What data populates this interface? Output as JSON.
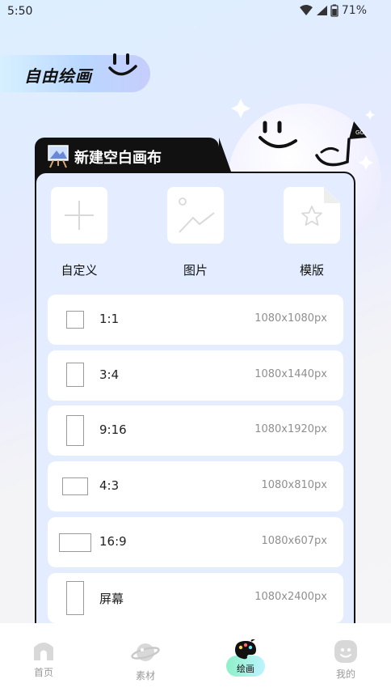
{
  "status_bar": {
    "time": "5:50",
    "battery": "71%"
  },
  "header": {
    "title": "自由绘画"
  },
  "card": {
    "tab_title": "新建空白画布",
    "options": [
      {
        "label": "自定义",
        "icon": "plus-icon"
      },
      {
        "label": "图片",
        "icon": "image-icon"
      },
      {
        "label": "模版",
        "icon": "star-doc-icon"
      }
    ],
    "ratios": [
      {
        "ratio": "1:1",
        "size": "1080x1080px"
      },
      {
        "ratio": "3:4",
        "size": "1080x1440px"
      },
      {
        "ratio": "9:16",
        "size": "1080x1920px"
      },
      {
        "ratio": "4:3",
        "size": "1080x810px"
      },
      {
        "ratio": "16:9",
        "size": "1080x607px"
      },
      {
        "ratio": "屏幕",
        "size": "1080x2400px"
      }
    ]
  },
  "bottom_nav": {
    "items": [
      {
        "label": "首页",
        "icon": "home-icon"
      },
      {
        "label": "素材",
        "icon": "planet-icon"
      },
      {
        "label": "绘画",
        "icon": "palette-icon",
        "active": true
      },
      {
        "label": "我的",
        "icon": "smile-face-icon"
      }
    ]
  }
}
